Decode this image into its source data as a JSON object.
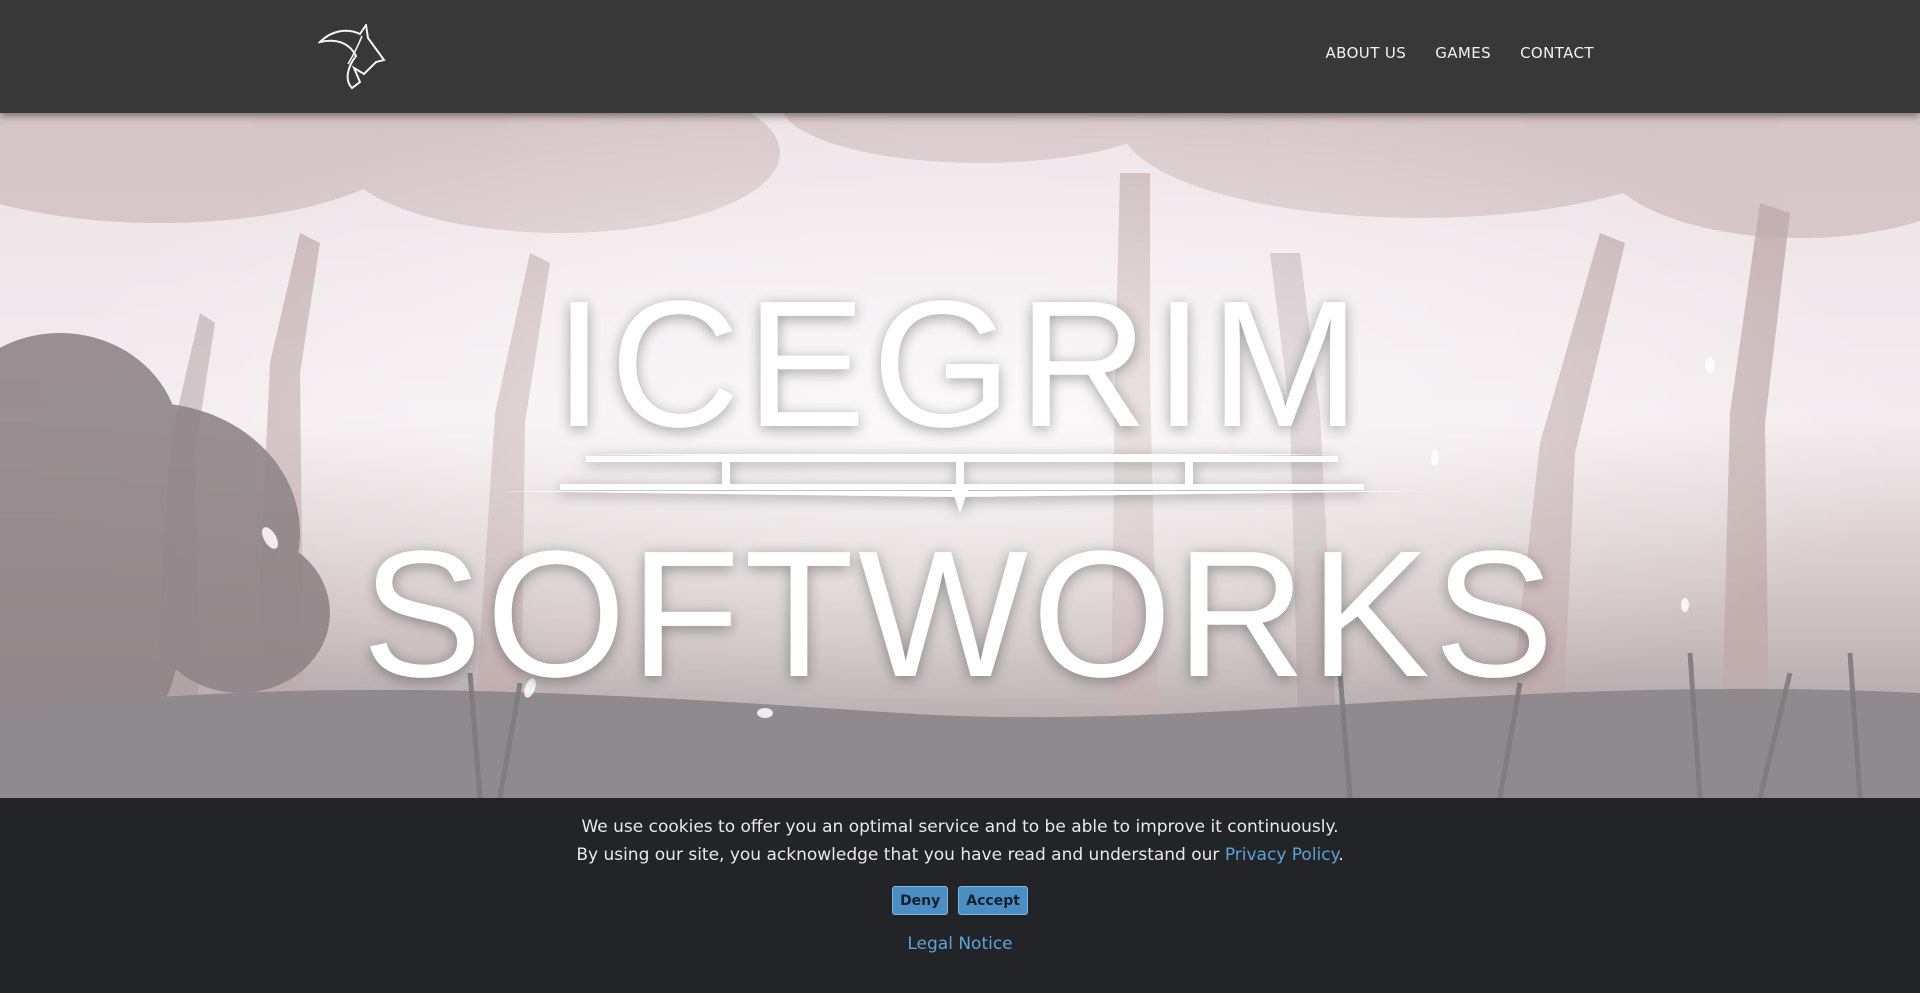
{
  "header": {
    "logo_icon": "wolf-head-icon",
    "nav": [
      {
        "label": "ABOUT US"
      },
      {
        "label": "GAMES"
      },
      {
        "label": "CONTACT"
      }
    ]
  },
  "hero": {
    "title_line1": "ICEGRIM",
    "title_line2": "SOFTWORKS"
  },
  "cookie": {
    "line1": "We use cookies to offer you an optimal service and to be able to improve it continuously.",
    "line2_prefix": "By using our site, you acknowledge that you have read and understand our ",
    "privacy_link": "Privacy Policy",
    "line2_suffix": ".",
    "deny_label": "Deny",
    "accept_label": "Accept",
    "legal_link": "Legal Notice",
    "link_color": "#5aa3d4",
    "button_color": "#4b8ec4"
  }
}
